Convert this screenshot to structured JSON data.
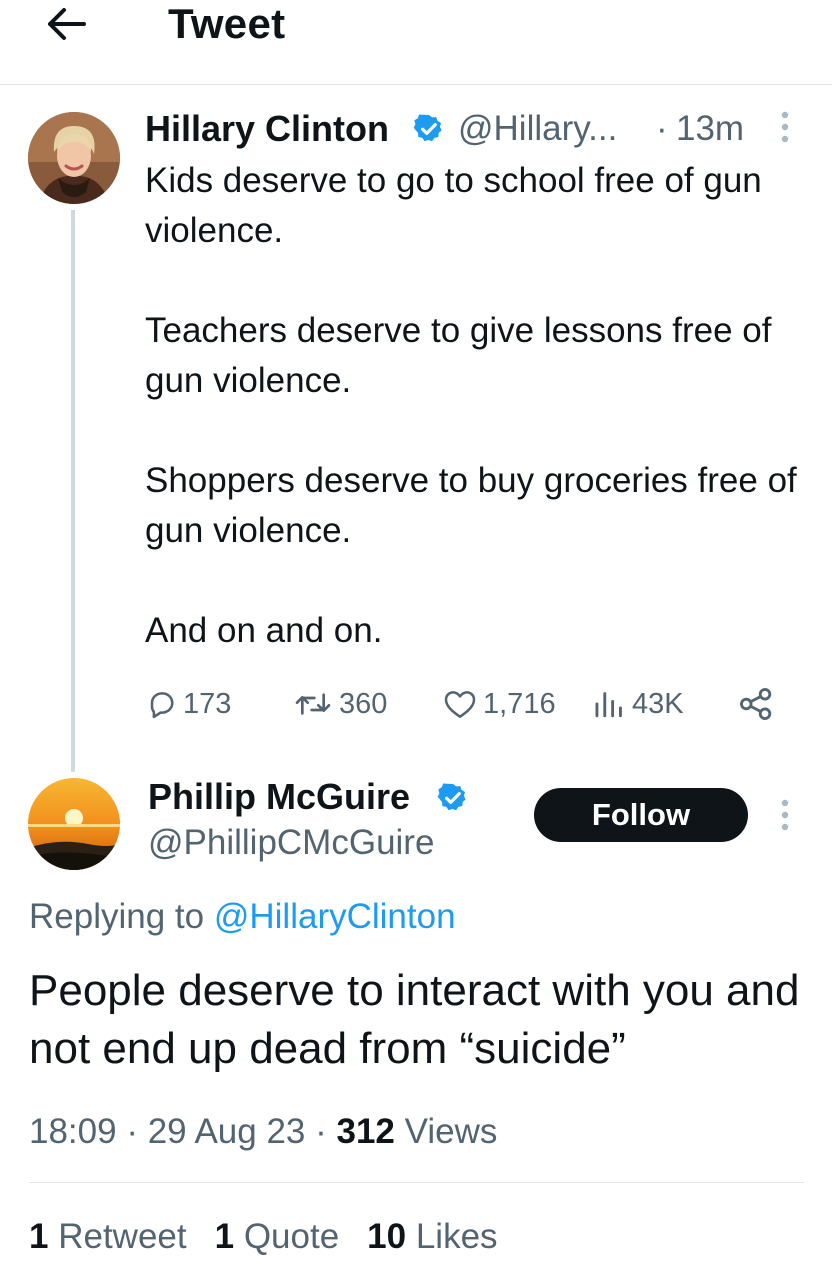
{
  "header": {
    "title": "Tweet",
    "back_icon": "arrow-left-icon"
  },
  "tweet1": {
    "author_name": "Hillary Clinton",
    "handle": "@Hillary...",
    "dot": "·",
    "time": "13m",
    "paragraphs": [
      "Kids deserve to go to school free of gun violence.",
      "Teachers deserve to give lessons free of gun violence.",
      "Shoppers deserve to buy groceries free of gun violence.",
      "And on and on."
    ],
    "actions": {
      "replies": "173",
      "retweets": "360",
      "likes": "1,716",
      "views": "43K"
    }
  },
  "tweet2": {
    "author_name": "Phillip McGuire",
    "handle": "@PhillipCMcGuire",
    "follow_label": "Follow",
    "replying_prefix": "Replying to",
    "replying_mention": "@HillaryClinton",
    "text": "People deserve to interact with you and not end up dead from “suicide”",
    "time": "18:09",
    "date": "29 Aug 23",
    "sep": "·",
    "views_count": "312",
    "views_label": "Views",
    "stats": {
      "retweets_count": "1",
      "retweets_label": "Retweet",
      "quotes_count": "1",
      "quotes_label": "Quote",
      "likes_count": "10",
      "likes_label": "Likes"
    }
  },
  "colors": {
    "text": "#0f1419",
    "secondary": "#536471",
    "accent": "#1d9bf0",
    "divider": "#e1e4e8"
  }
}
